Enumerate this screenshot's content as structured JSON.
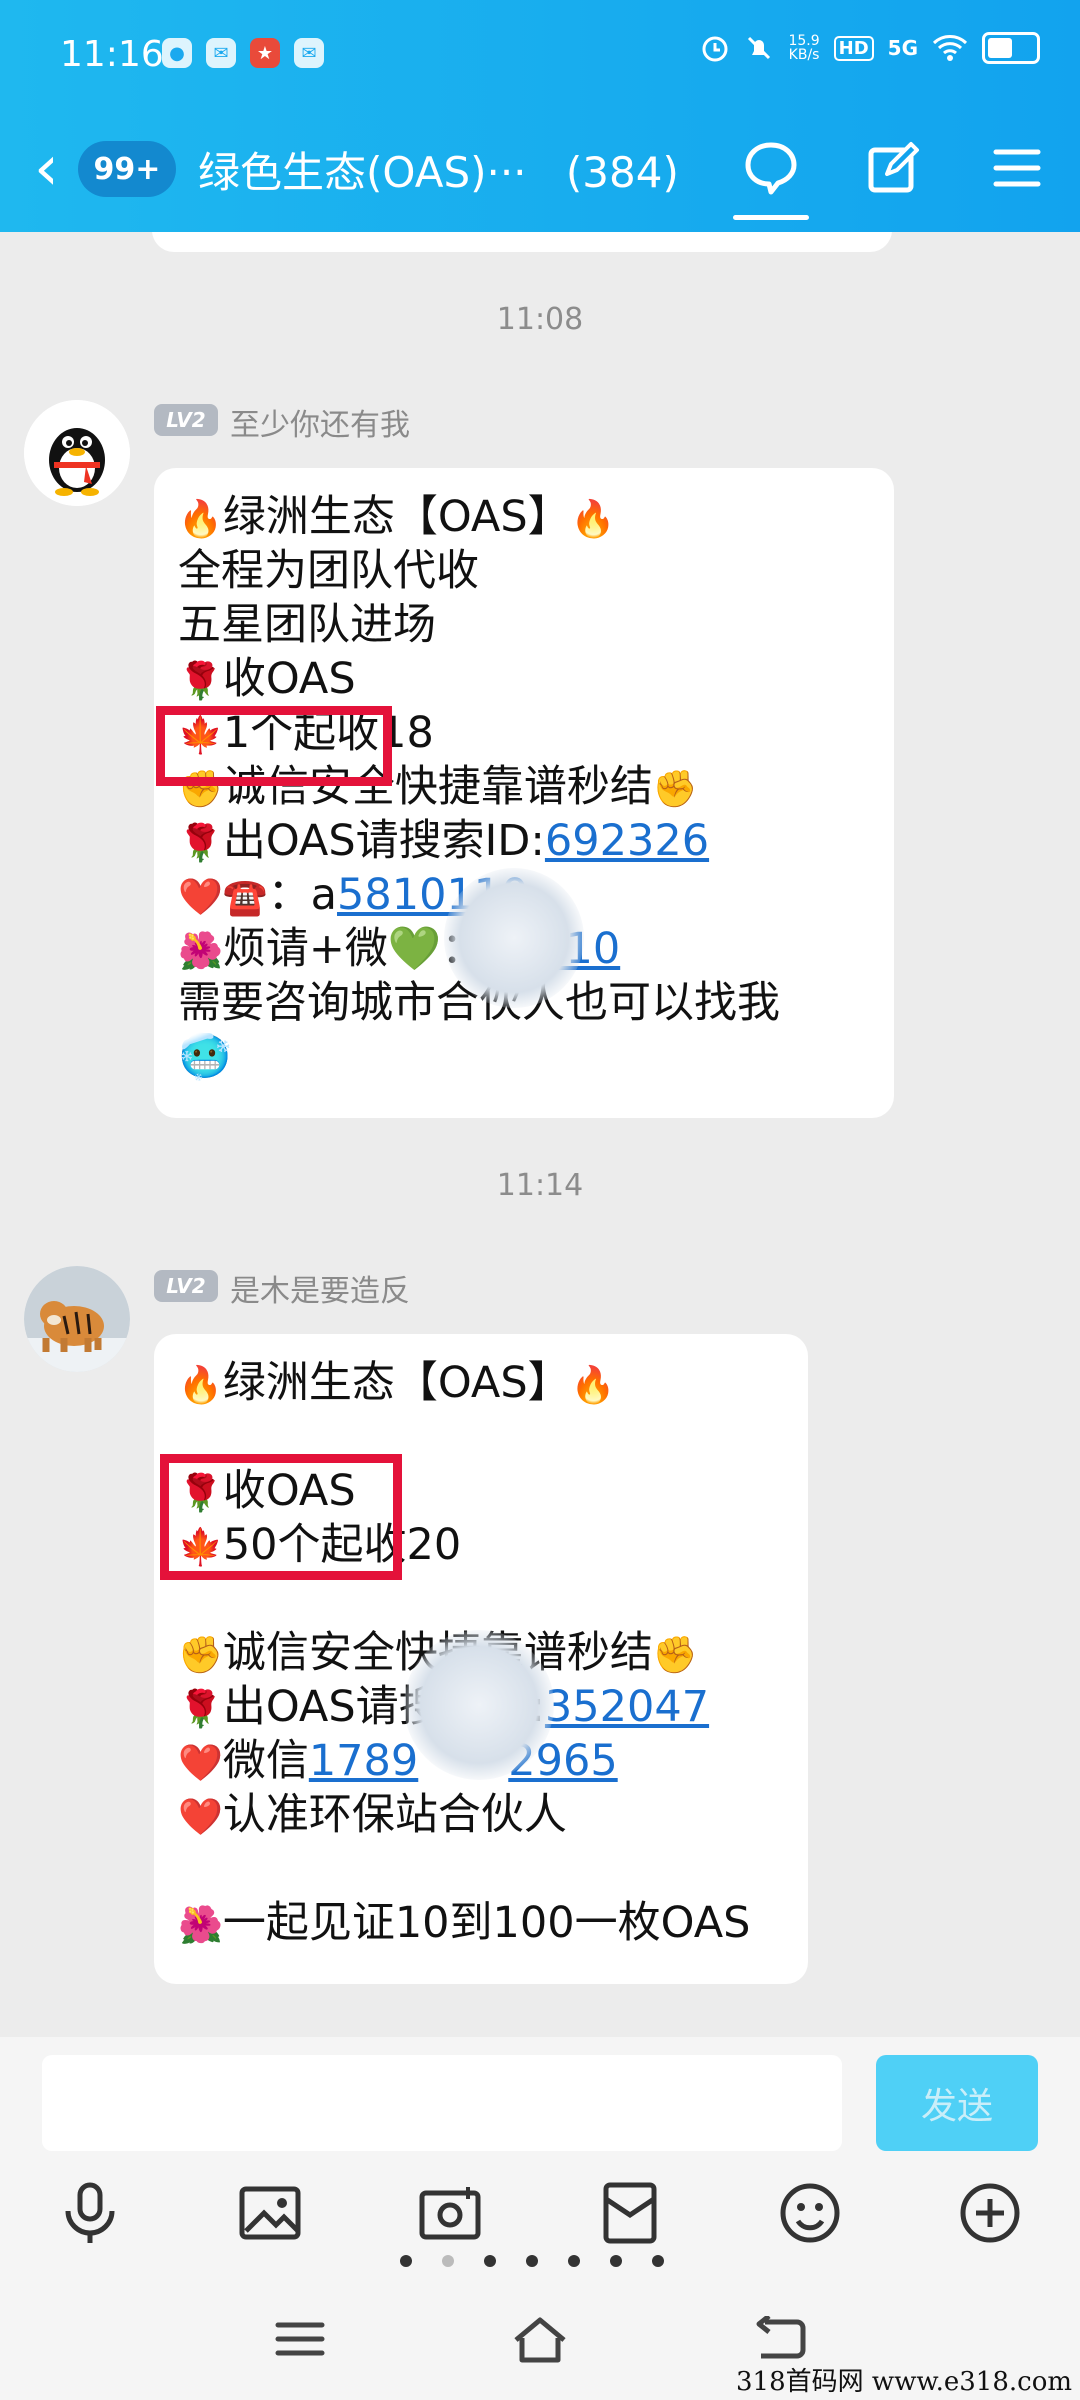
{
  "status_bar": {
    "time": "11:16",
    "net_speed": "15.9",
    "net_unit": "KB/s",
    "hd": "HD",
    "signal": "5G"
  },
  "header": {
    "unread_badge": "99+",
    "group_title": "绿色生态(OAS)···",
    "member_count": "(384)"
  },
  "messages": [
    {
      "timestamp": "11:08",
      "level": "LV2",
      "sender": "至少你还有我",
      "lines": [
        {
          "prefix": "🔥",
          "text": "绿洲生态【OAS】",
          "suffix": "🔥"
        },
        {
          "text": " 全程为团队代收"
        },
        {
          "text": " 五星团队进场"
        },
        {
          "prefix": "🌹",
          "text": "收OAS"
        },
        {
          "prefix": "🍁",
          "text": "1个起收18"
        },
        {
          "prefix": "✊",
          "text": "诚信安全快捷靠谱秒结",
          "suffix": "✊"
        },
        {
          "prefix": "🌹",
          "text": "出OAS请搜索ID:",
          "link": "692326"
        },
        {
          "prefix": "❤️☎️",
          "text": "：a",
          "link": "5810110"
        },
        {
          "prefix": "🌺",
          "text": "烦请+微💚：a",
          "link": "5810"
        },
        {
          "text": "需要咨询城市合伙人也可以找我"
        },
        {
          "text": "🥶"
        }
      ]
    },
    {
      "timestamp": "11:14",
      "level": "LV2",
      "sender": "是木是要造反",
      "lines": [
        {
          "prefix": "🔥",
          "text": "绿洲生态【OAS】",
          "suffix": "🔥"
        },
        {
          "text": ""
        },
        {
          "prefix": "🌹",
          "text": "收OAS"
        },
        {
          "prefix": "🍁",
          "text": "50个起收20"
        },
        {
          "text": ""
        },
        {
          "prefix": "✊",
          "text": "诚信安全快捷靠谱秒结",
          "suffix": "✊"
        },
        {
          "prefix": "🌹",
          "text": "出OAS请搜索ID:",
          "link": "352047"
        },
        {
          "prefix": "❤️",
          "text": "微信",
          "link": "1789",
          "link2": "2965"
        },
        {
          "prefix": "❤️",
          "text": "认准环保站合伙人"
        },
        {
          "text": ""
        },
        {
          "prefix": "🌺",
          "text": "一起见证10到100一枚OAS"
        }
      ]
    }
  ],
  "input": {
    "send_label": "发送"
  },
  "watermark": "318首码网 www.e318.com",
  "colors": {
    "header": "#12a3ee",
    "highlight_box": "#e4123a",
    "link": "#1a6fcf",
    "send_button": "#4fd0f6"
  }
}
